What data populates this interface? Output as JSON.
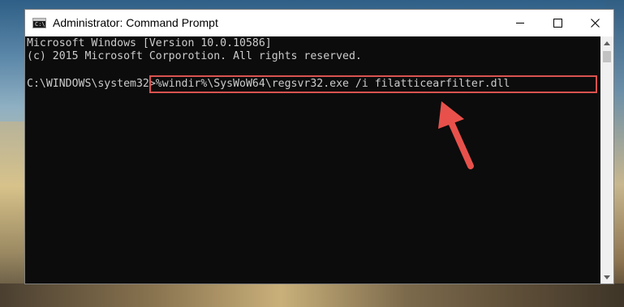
{
  "window": {
    "title": "Administrator: Command Prompt",
    "app_icon": "cmd-icon",
    "app_icon_text": "C:\\",
    "controls": [
      "minimize-icon",
      "maximize-icon",
      "close-icon"
    ]
  },
  "console": {
    "line1": "Microsoft Windows [Version 10.0.10586]",
    "line2": "(c) 2015 Microsoft Corporotion. All rights reserved.",
    "prompt": "C:\\WINDOWS\\system32>",
    "command": "%windir%\\SysWoW64\\regsvr32.exe /i filatticearfilter.dll"
  },
  "annotation": {
    "highlight_color": "#d9534f",
    "arrow_color": "#e8514b"
  },
  "colors": {
    "console_bg": "#0c0c0c",
    "console_text": "#cccccc"
  }
}
